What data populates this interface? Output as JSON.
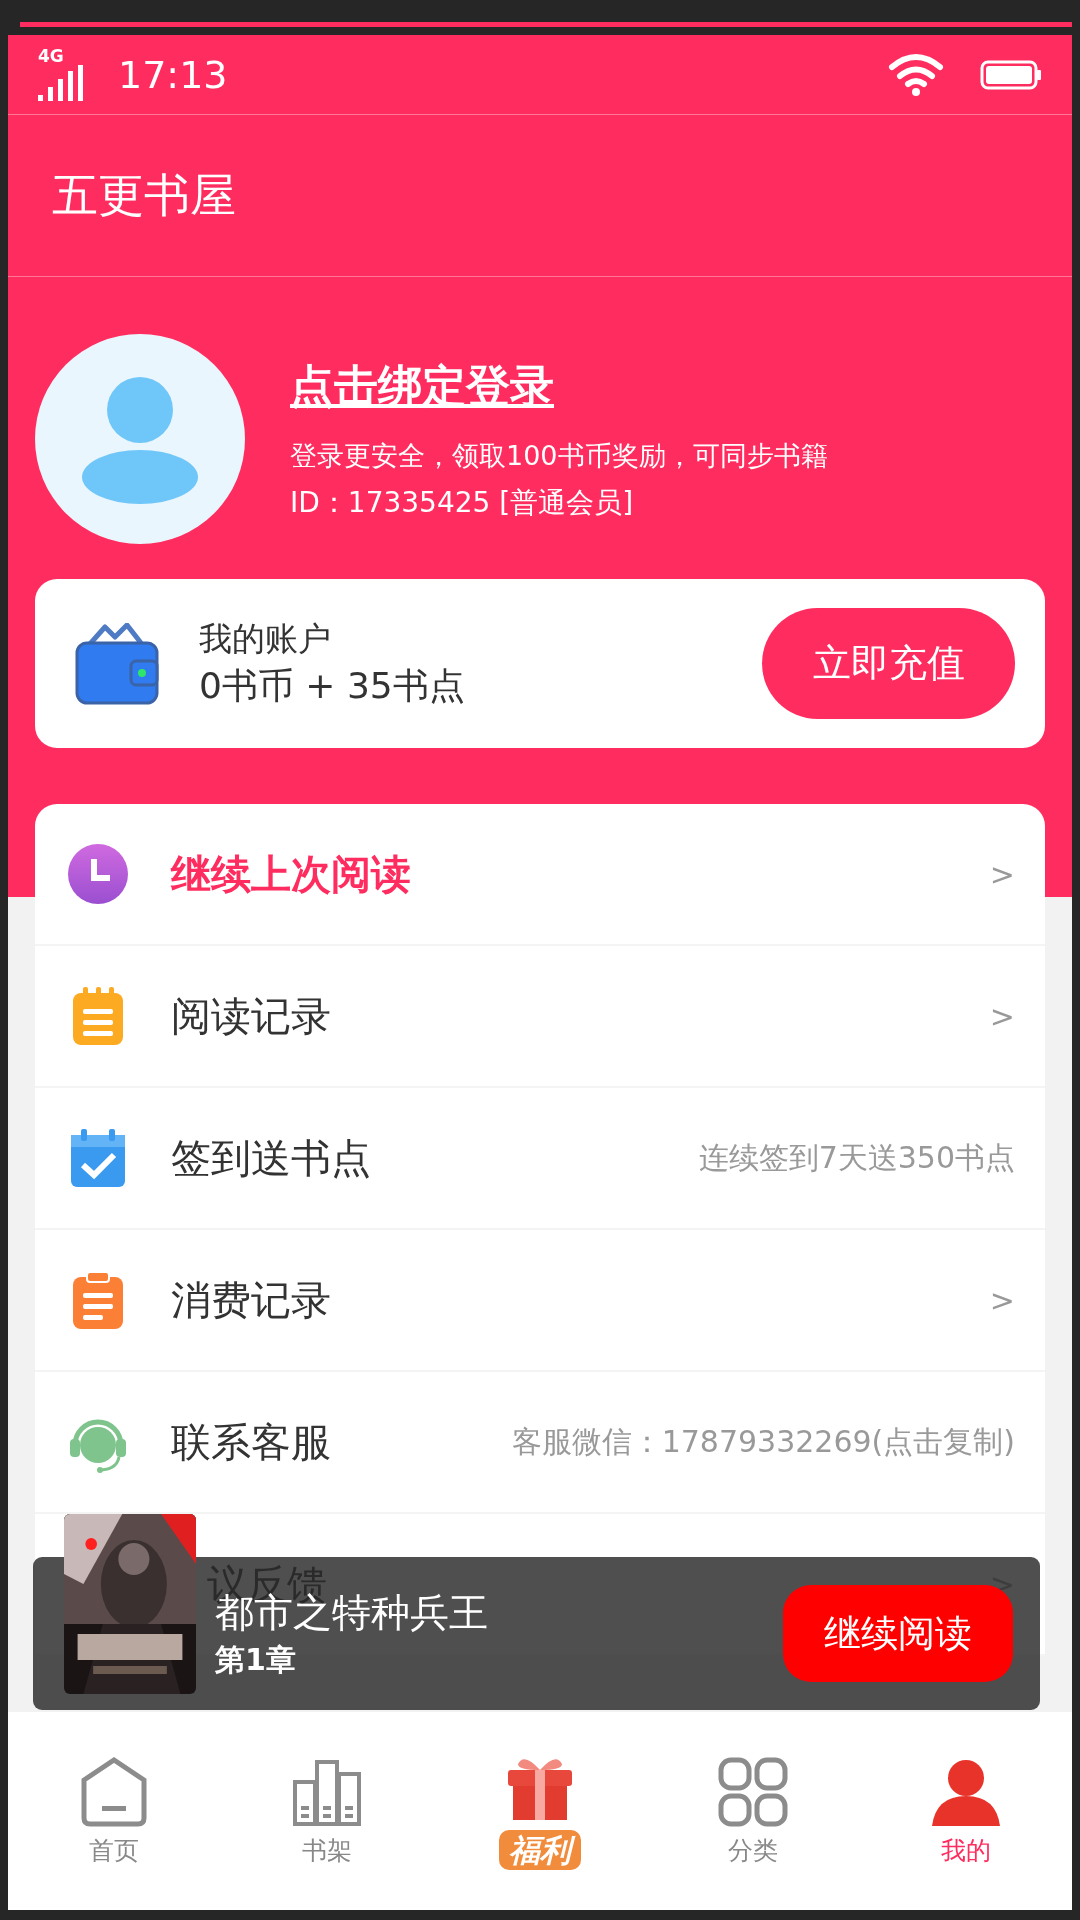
{
  "status_bar": {
    "network": "4G",
    "time": "17:13"
  },
  "header": {
    "title": "五更书屋"
  },
  "profile": {
    "login_link": "点击绑定登录",
    "subtitle": "登录更安全，领取100书币奖励，可同步书籍",
    "id_line": "ID：17335425 [普通会员]"
  },
  "account": {
    "title": "我的账户",
    "balance": "0书币 + 35书点",
    "recharge_button": "立即充值"
  },
  "menu": [
    {
      "label": "继续上次阅读",
      "highlighted": true,
      "arrow": ">"
    },
    {
      "label": "阅读记录",
      "highlighted": false,
      "arrow": ">"
    },
    {
      "label": "签到送书点",
      "highlighted": false,
      "hint": "连续签到7天送350书点"
    },
    {
      "label": "消费记录",
      "highlighted": false,
      "arrow": ">"
    },
    {
      "label": "联系客服",
      "highlighted": false,
      "hint": "客服微信：17879332269(点击复制)"
    },
    {
      "label": "议反馈",
      "highlighted": false,
      "arrow": ">"
    }
  ],
  "reading_banner": {
    "title": "都市之特种兵王",
    "chapter": "第1章",
    "button": "继续阅读"
  },
  "tabs": [
    {
      "label": "首页",
      "kind": "plain",
      "selected": false
    },
    {
      "label": "书架",
      "kind": "plain",
      "selected": false
    },
    {
      "label": "福利",
      "kind": "badge",
      "selected": false
    },
    {
      "label": "分类",
      "kind": "plain",
      "selected": false
    },
    {
      "label": "我的",
      "kind": "plain",
      "selected": true
    }
  ]
}
